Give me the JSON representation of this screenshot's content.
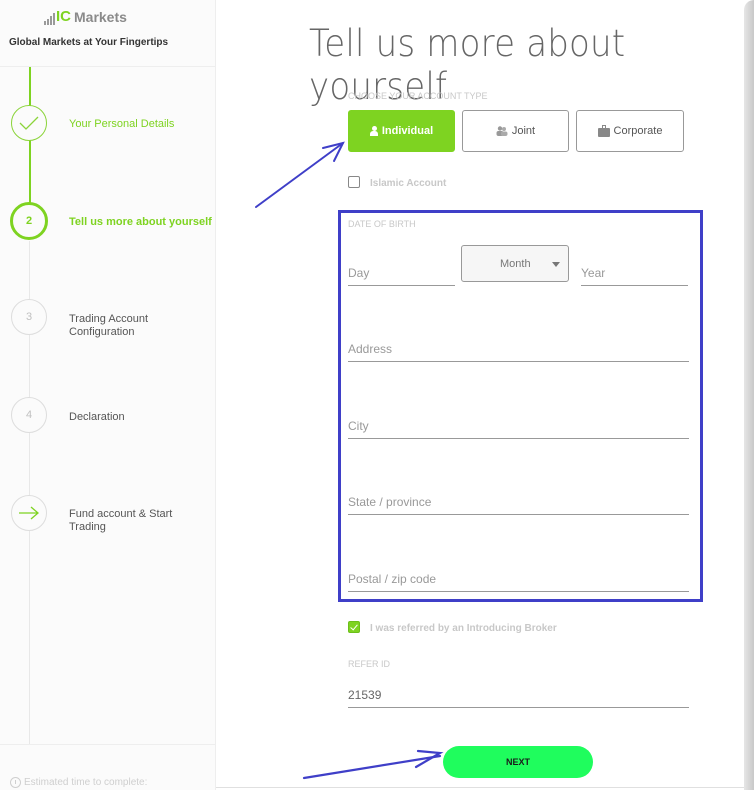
{
  "brand": {
    "logo_ic": "IC",
    "logo_markets": "Markets",
    "tagline": "Global Markets at Your Fingertips"
  },
  "steps": [
    {
      "marker": "check-icon",
      "label": "Your Personal Details",
      "state": "done"
    },
    {
      "marker": "2",
      "label": "Tell us more about yourself",
      "state": "active"
    },
    {
      "marker": "3",
      "label": "Trading Account Configuration",
      "state": "pending"
    },
    {
      "marker": "4",
      "label": "Declaration",
      "state": "pending"
    },
    {
      "marker": "arrow-right-icon",
      "label": "Fund account & Start Trading",
      "state": "pending"
    }
  ],
  "sidebar_footer": {
    "estimated_time": "Estimated time to complete:"
  },
  "main": {
    "title": "Tell us more about yourself",
    "account_type": {
      "label": "CHOOSE YOUR ACCOUNT TYPE",
      "options": [
        {
          "label": "Individual",
          "icon": "person-icon",
          "selected": true
        },
        {
          "label": "Joint",
          "icon": "people-icon",
          "selected": false
        },
        {
          "label": "Corporate",
          "icon": "briefcase-icon",
          "selected": false
        }
      ]
    },
    "islamic_account": {
      "label": "Islamic Account",
      "checked": false
    },
    "dob": {
      "label": "DATE OF BIRTH",
      "day_placeholder": "Day",
      "month_selected": "Month",
      "year_placeholder": "Year"
    },
    "address_placeholder": "Address",
    "city_placeholder": "City",
    "state_placeholder": "State / province",
    "postal_placeholder": "Postal / zip code",
    "referred": {
      "label": "I was referred by an Introducing Broker",
      "checked": true
    },
    "refer_id": {
      "label": "REFER ID",
      "value": "21539"
    },
    "next_label": "NEXT"
  },
  "colors": {
    "brand_green": "#7ed321",
    "next_button": "#1ffd5d",
    "annotation_blue": "#3f3fc8"
  }
}
